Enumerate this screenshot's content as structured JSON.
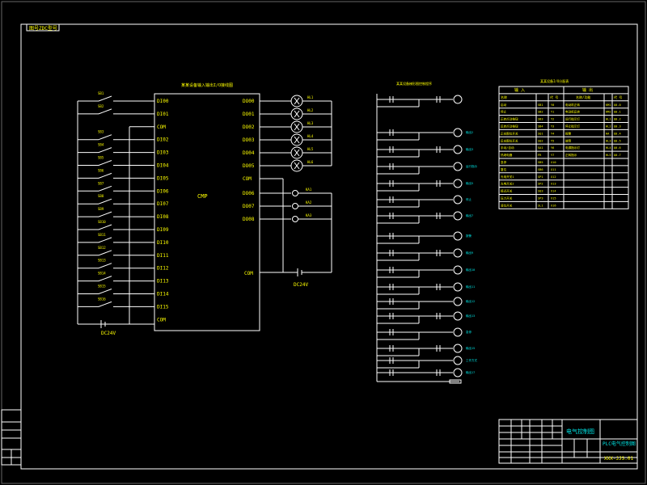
{
  "corner_tag": "图号ZDC型号",
  "plc": {
    "title": "某某设备输入输出I/O接线图",
    "model": "CMP",
    "inputs": [
      "DI00",
      "DI01",
      "COM",
      "DI02",
      "DI03",
      "DI04",
      "DI05",
      "DI06",
      "DI07",
      "DI08",
      "DI09",
      "DI10",
      "DI11",
      "DI12",
      "DI13",
      "DI14",
      "DI15",
      "COM"
    ],
    "outputs": [
      "DO00",
      "DO01",
      "DO02",
      "DO03",
      "DO04",
      "DO05",
      "COM",
      "DO06",
      "DO07",
      "DO08"
    ],
    "com_out": "COM",
    "dc_left": "DC24V",
    "dc_right": "DC24V",
    "switch_labels": [
      "SB1",
      "SB2",
      "SB3",
      "SB4",
      "SB5",
      "SB6",
      "SB7",
      "SB8",
      "SB9",
      "SB10",
      "SB11",
      "SB12",
      "SB13",
      "SB14",
      "SB15",
      "SB16"
    ],
    "lamp_labels": [
      "HL1",
      "HL2",
      "HL3",
      "HL4",
      "HL5",
      "HL6"
    ],
    "relay_labels": [
      "KA1",
      "KA2",
      "KA3"
    ]
  },
  "ladder": {
    "title": "某某设备梯形图控制程序",
    "coil_labels": [
      "输出1",
      "输出2",
      "输出3",
      "运行指示",
      "输出5",
      "停止",
      "输出7",
      "报警",
      "输出9",
      "输出10",
      "输出11",
      "输出12",
      "输出13",
      "急停",
      "输出15",
      "工作方式",
      "输出17",
      "输出18"
    ]
  },
  "io_table": {
    "title": "某某设备I/O分配表",
    "header_input": "输  入",
    "header_output": "输  出",
    "sub_headers": [
      "名称",
      "代 号",
      "名称/功能",
      "代 号"
    ],
    "rows": [
      [
        "启动",
        "SB1",
        "Y0",
        "电动机正转",
        "KM1",
        "Q0.0"
      ],
      [
        "停止",
        "SB2",
        "Y1",
        "电动机反转",
        "KM2",
        "Q0.1"
      ],
      [
        "正转点动按钮",
        "SB3",
        "Y2",
        "运行指示灯",
        "HL1",
        "Q0.2"
      ],
      [
        "反转点动按钮",
        "SB4",
        "Y3",
        "停止指示灯",
        "HL2",
        "Q0.3"
      ],
      [
        "正向限位开关",
        "SQ1",
        "Y4",
        "报警",
        "HA",
        "Q0.4"
      ],
      [
        "反向限位开关",
        "SQ2",
        "Y5",
        "故障",
        "HL3",
        "Q0.5"
      ],
      [
        "手动/自动",
        "SA1",
        "Y6",
        "电源指示灯",
        "HL4",
        "Q0.6"
      ],
      [
        "热继电器",
        "FR",
        "Y7",
        "正转指示",
        "HL5",
        "Q0.7"
      ],
      [
        "急停",
        "SB5",
        "X10",
        "",
        "",
        ""
      ],
      [
        "复位",
        "SB6",
        "X11",
        "",
        "",
        ""
      ],
      [
        "光电开关1",
        "SP1",
        "X12",
        "",
        "",
        ""
      ],
      [
        "光电开关2",
        "SP2",
        "X13",
        "",
        "",
        ""
      ],
      [
        "接近开关",
        "SQ3",
        "X14",
        "",
        "",
        ""
      ],
      [
        "压力开关",
        "SP3",
        "X15",
        "",
        "",
        ""
      ],
      [
        "液位开关",
        "SL1",
        "X16",
        "",
        "",
        ""
      ]
    ]
  },
  "title_block": {
    "drawing_title": "电气控制图",
    "right_title": "PLC电气控制图",
    "drawing_no": "XXX-JJS.01",
    "labels": [
      "设计",
      "校对",
      "审核",
      "工艺",
      "批准",
      "日期",
      "比例",
      "共  张",
      "第  张",
      "单位"
    ],
    "side_stamp": [
      "借(通)用件登记",
      "旧底图总号",
      "底图总号",
      "签字",
      "日期"
    ]
  }
}
